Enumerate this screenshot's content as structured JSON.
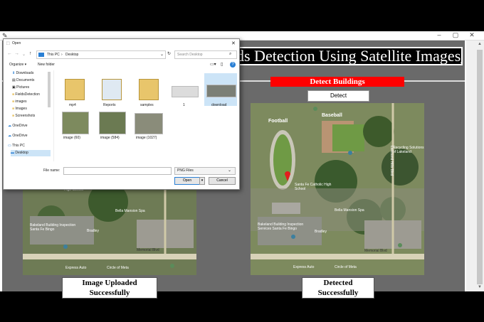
{
  "app": {
    "title": "ds Detection Using Satellite Images__",
    "detect_header": "Detect Buildings",
    "detect_button": "Detect",
    "left_caption": "Image Uploaded Successfully",
    "right_caption": "Detected Successfully",
    "map_labels": {
      "school": "Santa Fe Catholic High School",
      "school_short": "High School",
      "spa": "Bella Mansion Spa",
      "bakery": "Bakeland Building Inspection Services Santa Fe Bingo",
      "bakery_short": "Bakeland Building Inspection Santa Fe Bingo",
      "bradley": "Bradley",
      "memorial": "Memorial Blvd",
      "express": "Express Auto",
      "circle": "Circle of Meta",
      "football": "Football",
      "baseball": "Baseball",
      "recycling": "Recycling Solutions of Lakeland",
      "north": "Lakeland Hills Blvd"
    }
  },
  "dialog": {
    "title": "Open",
    "breadcrumb": [
      "This PC",
      "Desktop"
    ],
    "search_placeholder": "Search Desktop",
    "organize": "Organize ▾",
    "new_folder": "New folder",
    "nav_items": [
      "Downloads",
      "Documents",
      "Pictures",
      "FieldsDetection",
      "images",
      "Images",
      "Screenshots",
      "OneDrive",
      "OneDrive",
      "This PC",
      "Desktop"
    ],
    "files": [
      {
        "name": "mp4",
        "kind": "folder"
      },
      {
        "name": "Reports",
        "kind": "folder"
      },
      {
        "name": "samples",
        "kind": "folder"
      },
      {
        "name": "1",
        "kind": "image"
      },
      {
        "name": "download",
        "kind": "image"
      },
      {
        "name": "image (60)",
        "kind": "image"
      },
      {
        "name": "image (584)",
        "kind": "image"
      },
      {
        "name": "image (1027)",
        "kind": "image"
      }
    ],
    "filename_label": "File name:",
    "filetype": "PNG Files",
    "open_button": "Open",
    "cancel_button": "Cancel"
  },
  "colors": {
    "accent": "#ff0000",
    "body_bg": "#6a6a6a",
    "title_bg": "#000000"
  }
}
